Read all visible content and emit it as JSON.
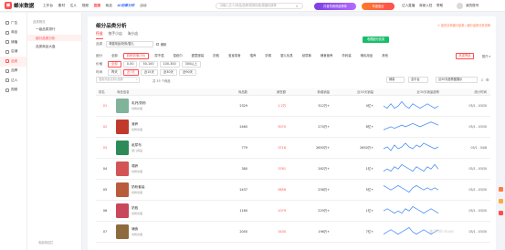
{
  "topbar": {
    "brand": "蝉米数据",
    "nav": [
      "工作台",
      "素材",
      "达人",
      "视频",
      "直播",
      "商品",
      "品牌",
      "视频",
      "页面"
    ],
    "nav_active_index": 4,
    "promo": "AI创意分析",
    "extra_nav": "活动",
    "search_placeholder": "请输入达人/商品/品牌/视频标题/直播标题等",
    "pill_purple": "抖音热销商品榜单",
    "pill_orange": "年度盘点",
    "links": [
      "达人直播",
      "商家入驻",
      "帮助"
    ],
    "user": "我的账号"
  },
  "rail": {
    "items": [
      "广告",
      "商品",
      "铺播",
      "店铺",
      "品类",
      "品牌",
      "达人",
      "视频"
    ],
    "active_index": 4
  },
  "subbar": {
    "head": "品类概览",
    "items": [
      "一级品类排行",
      "细分品类分析",
      "品类商品大盘"
    ],
    "active_index": 1,
    "footer": "收起侧边栏"
  },
  "main": {
    "title": "细分品类分析",
    "tabs": [
      "行业",
      "快手小店",
      "淘小店"
    ],
    "notice": "① 如何分析细分品类 / 细分品类分析说明",
    "category_label": "品类",
    "category_value": "母婴用品/奶粉/婴儿",
    "category_option": "爆款",
    "fav_button": "收藏细分品类",
    "filters": [
      {
        "label": "细分",
        "chips": [
          "全部",
          "奶粉奶瓶(35)",
          "尿不湿",
          "湿纸巾",
          "婴童服装",
          "奶瓶",
          "宝宝零食",
          "喂养",
          "奶嘴",
          "婴儿玩具",
          "纸尿裤",
          "辅食营养",
          "孕妈装",
          "哺乳用品",
          "其他"
        ],
        "selected": 1
      },
      {
        "label": "价格",
        "chips": [
          "全部",
          "0-50",
          "50-100",
          "100-300",
          "300以上"
        ],
        "selected": 0
      },
      {
        "label": "时间",
        "chips": [
          "昨天",
          "近7天",
          "近15天",
          "近30天",
          "近90天"
        ],
        "selected": 1
      }
    ],
    "filter_button": "品类筛选",
    "more_button": "展开 ▾",
    "table_search_placeholder": "搜索商品名称/品牌",
    "table_hint": "共 33 个商品",
    "sort_select": "销量",
    "platform_select": "全平台",
    "trend_select": "近30天趋势图展示",
    "columns": [
      "排名",
      "商品信息",
      "商品数",
      "销售额",
      "新增销量",
      "近30天销量",
      "近30天销量趋势",
      "统计时间"
    ],
    "rows": [
      {
        "rank": "01",
        "name": "乳钙/奶粉",
        "tag": "奶粉奶瓶",
        "count": "2329",
        "amount": "1.2万",
        "new_sales": "312万+",
        "sales30": "4亿+",
        "date": "03/1 - 03/30",
        "color": "#7fb39a",
        "trend": [
          6,
          5,
          7,
          5,
          6,
          8,
          6,
          5,
          7,
          6,
          5,
          6,
          7,
          6,
          5,
          6
        ]
      },
      {
        "rank": "02",
        "name": "营养",
        "tag": "奶粉奶瓶",
        "count": "2460",
        "amount": "3070",
        "new_sales": "274万+",
        "sales30": "8亿+",
        "date": "03/1 - 03/30",
        "color": "#c0392b",
        "trend": [
          4,
          5,
          6,
          5,
          6,
          7,
          6,
          7,
          8,
          7,
          6,
          7,
          8,
          9,
          8,
          7
        ]
      },
      {
        "rank": "03",
        "name": "纸尿布",
        "tag": "婴儿用品",
        "count": "779",
        "amount": "3716",
        "new_sales": "2650万+",
        "sales30": "2650万+",
        "date": "03/1 - 04/8",
        "color": "#2e8b57",
        "trend": [
          5,
          6,
          4,
          7,
          5,
          6,
          8,
          6,
          5,
          7,
          6,
          8,
          7,
          6,
          5,
          6
        ]
      },
      {
        "rank": "04",
        "name": "喂养",
        "tag": "奶粉奶瓶",
        "count": "380",
        "amount": "3761",
        "new_sales": "262万+",
        "sales30": "1亿+",
        "date": "03/1 - 03/30",
        "color": "#d35454",
        "trend": [
          5,
          6,
          5,
          7,
          6,
          8,
          7,
          6,
          5,
          7,
          6,
          5,
          7,
          6,
          8,
          6
        ]
      },
      {
        "rank": "05",
        "name": "奶粉套装",
        "tag": "奶粉奶瓶",
        "count": "2437",
        "amount": "9856",
        "new_sales": "258万+",
        "sales30": "5亿+",
        "date": "03/1 - 03/30",
        "color": "#b85c3c",
        "trend": [
          7,
          6,
          5,
          6,
          7,
          6,
          5,
          4,
          6,
          7,
          6,
          5,
          6,
          5,
          6,
          5
        ]
      },
      {
        "rank": "06",
        "name": "奶瓶",
        "tag": "奶粉奶瓶",
        "count": "1160",
        "amount": "1079",
        "new_sales": "229万+",
        "sales30": "1亿+",
        "date": "03/1 - 03/30",
        "color": "#c9475a",
        "trend": [
          6,
          7,
          6,
          5,
          6,
          5,
          7,
          6,
          8,
          7,
          6,
          5,
          6,
          7,
          6,
          5
        ]
      },
      {
        "rank": "07",
        "name": "辅食",
        "tag": "奶粉奶瓶",
        "count": "2045",
        "amount": "3430",
        "new_sales": "196万+",
        "sales30": "7亿+",
        "date": "03/1 - 03/30",
        "color": "#8e6b3f",
        "trend": [
          5,
          6,
          7,
          6,
          5,
          6,
          7,
          8,
          6,
          5,
          6,
          7,
          6,
          5,
          6,
          7
        ]
      }
    ]
  },
  "watermark": "激活 Windows",
  "accent": "#ff4d4f"
}
